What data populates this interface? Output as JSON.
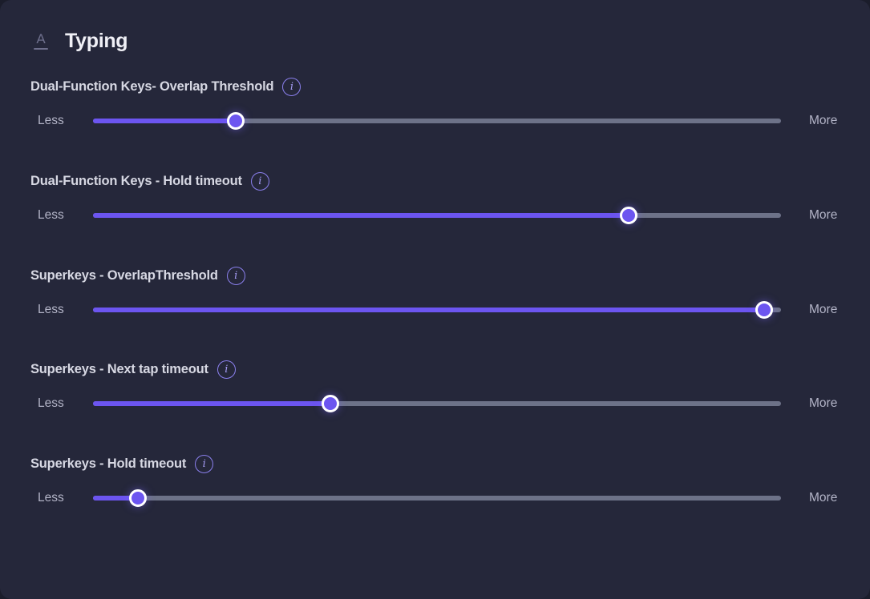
{
  "header": {
    "title": "Typing",
    "icon": "text-a-icon",
    "icon_glyph": "A"
  },
  "labels": {
    "less": "Less",
    "more": "More",
    "info_glyph": "i"
  },
  "colors": {
    "accent": "#6c55f0",
    "track": "#6d7288",
    "background": "#25273a"
  },
  "settings": [
    {
      "label": "Dual-Function Keys- Overlap Threshold",
      "value": 0.207
    },
    {
      "label": "Dual-Function Keys - Hold timeout",
      "value": 0.778
    },
    {
      "label": "Superkeys - OverlapThreshold",
      "value": 0.975
    },
    {
      "label": "Superkeys - Next tap timeout",
      "value": 0.345
    },
    {
      "label": "Superkeys - Hold timeout",
      "value": 0.065
    }
  ]
}
